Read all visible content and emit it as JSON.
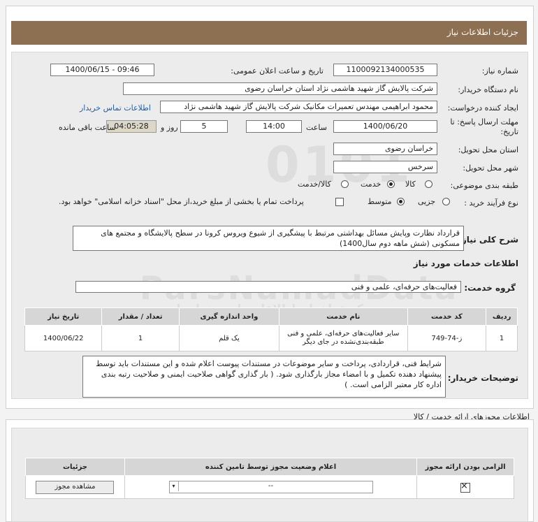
{
  "header": {
    "title": "جزئیات اطلاعات نیاز"
  },
  "form": {
    "need_number": {
      "label": "شماره نیاز:",
      "value": "1100092134000535"
    },
    "announce_datetime": {
      "label": "تاریخ و ساعت اعلان عمومی:",
      "value": "1400/06/15 - 09:46"
    },
    "buyer_org": {
      "label": "نام دستگاه خریدار:",
      "value": "شرکت پالایش گاز شهید هاشمی نژاد   استان خراسان رضوی"
    },
    "requester": {
      "label": "ایجاد کننده درخواست:",
      "value": "محمود ابراهیمی مهندس تعمیرات مکانیک شرکت پالایش گاز شهید هاشمی نژاد",
      "contact_link": "اطلاعات تماس خریدار"
    },
    "deadline": {
      "label_line1": "مهلت ارسال پاسخ: تا",
      "label_line2": "تاریخ:",
      "date": "1400/06/20",
      "time_label": "ساعت",
      "time": "14:00",
      "days": "5",
      "days_label": "روز و",
      "remaining": "04:05:28",
      "remaining_label": "ساعت باقی مانده"
    },
    "delivery_province": {
      "label": "استان محل تحویل:",
      "value": "خراسان رضوی"
    },
    "delivery_city": {
      "label": "شهر محل تحویل:",
      "value": "سرخس"
    },
    "category": {
      "label": "طبقه بندی موضوعی:",
      "options": [
        "کالا",
        "خدمت",
        "کالا/خدمت"
      ],
      "selected": "خدمت"
    },
    "purchase_type": {
      "label": "نوع فرآیند خرید :",
      "options": [
        "جزیی",
        "متوسط"
      ],
      "selected": "متوسط",
      "treasury_note": "پرداخت تمام یا بخشی از مبلغ خرید،از محل \"اسناد خزانه اسلامی\" خواهد بود."
    },
    "description": {
      "label": "شرح کلی نیاز:",
      "value": "قرارداد نظارت وپایش مسائل بهداشتی  مرتبط با پیشگیری از شیوع ویروس کرونا در سطح پالایشگاه و مجتمع های مسکونی  (شش ماهه دوم سال1400)"
    },
    "services_info_title": "اطلاعات خدمات مورد نیاز",
    "service_group": {
      "label": "گروه خدمت:",
      "value": "فعالیت‌های حرفه‌ای، علمی و فنی"
    },
    "items_table": {
      "headers": [
        "ردیف",
        "کد خدمت",
        "نام خدمت",
        "واحد اندازه گیری",
        "تعداد / مقدار",
        "تاریخ نیاز"
      ],
      "rows": [
        [
          "1",
          "ز-74-749",
          "سایر فعالیت‌های حرفه‌ای، علمی و فنی طبقه‌بندی‌نشده در جای دیگر",
          "یک قلم",
          "1",
          "1400/06/22"
        ]
      ]
    },
    "buyer_notes": {
      "label": "توضیحات خریدار:",
      "value": "شرایط فنی، قراردادی، پرداخت و سایر موضوعات در مستندات پیوست اعلام شده و این مستندات باید توسط پیشنهاد دهنده تکمیل و با امضاء مجاز بارگذاری شود. ( بار گذاری گواهی صلاحیت ایمنی و صلاحیت رتبه بندی اداره کار معتبر الزامی است. )"
    }
  },
  "permits": {
    "section_title": "اطلاعات مجوزهای ارائه خدمت / کالا",
    "headers": [
      "الزامی بودن ارائه مجوز",
      "اعلام وضعیت مجوز توسط تامین کننده",
      "جزئیات"
    ],
    "row": {
      "select_value": "--",
      "view_button": "مشاهده مجوز"
    }
  },
  "watermark": {
    "line1": "ParsNamadData",
    "line2": "مرکز فراخوان اطلاعات پارس نماد داده",
    "line3": "پایگاه اطلاع رسانی مناقصه و مزایده"
  },
  "colors": {
    "title_bar": "#8d6f52",
    "panel": "#ececec",
    "link": "#1a5fb4"
  }
}
